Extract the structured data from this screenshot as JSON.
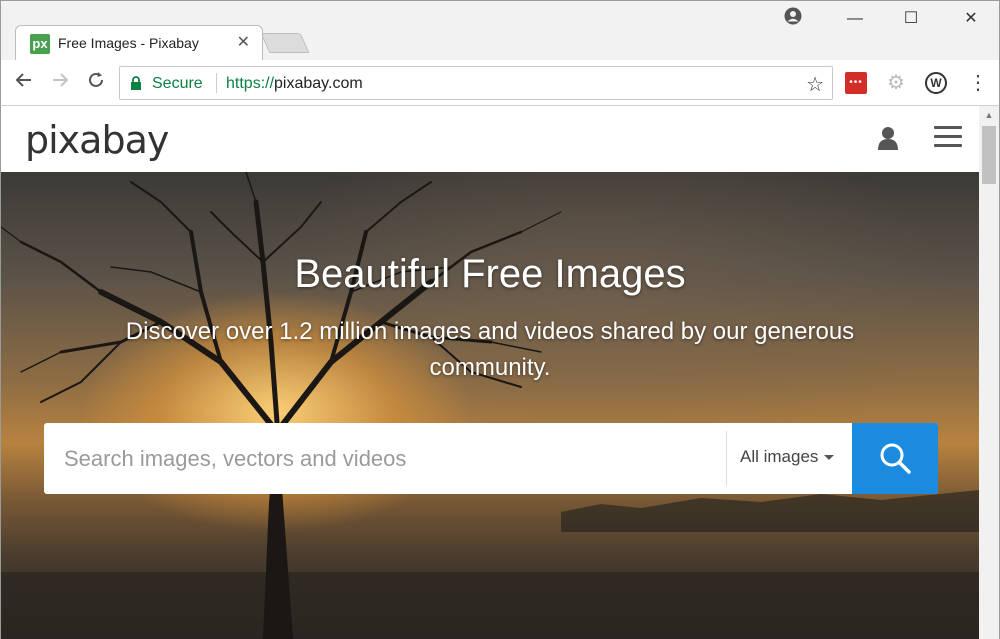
{
  "browser": {
    "tab": {
      "favicon_text": "px",
      "title": "Free Images - Pixabay",
      "close": "✕"
    },
    "window_controls": {
      "minimize": "—",
      "maximize": "☐",
      "close": "✕"
    },
    "omnibox": {
      "secure_label": "Secure",
      "url_scheme": "https://",
      "url_host": "pixabay.com"
    },
    "extensions": {
      "lastpass": "•••",
      "w": "W"
    },
    "icons": [
      "back-arrow-icon",
      "forward-arrow-icon",
      "reload-icon",
      "lock-icon",
      "star-icon",
      "gear-icon",
      "menu-dots-icon",
      "account-icon"
    ]
  },
  "site": {
    "logo": "pixabay",
    "hero": {
      "title": "Beautiful Free Images",
      "subtitle": "Discover over 1.2 million images and videos shared by our generous community."
    },
    "search": {
      "placeholder": "Search images, vectors and videos",
      "value": "",
      "filter_label": "All images"
    },
    "colors": {
      "search_button": "#1b8be0",
      "secure_green": "#0b8043"
    }
  }
}
